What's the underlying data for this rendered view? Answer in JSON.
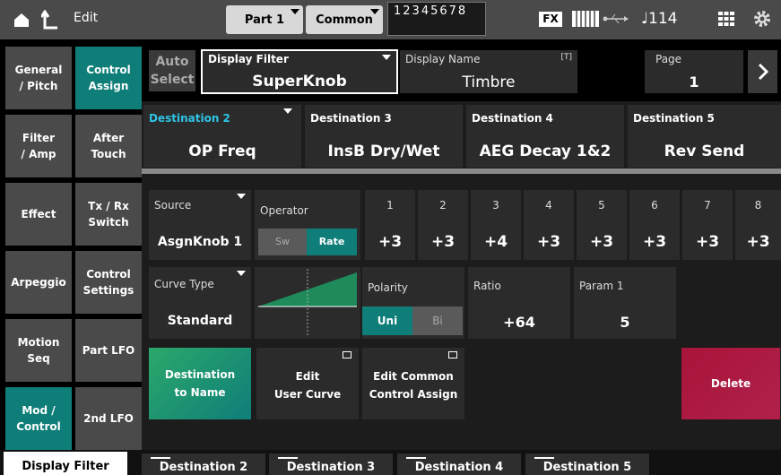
{
  "topbar": {
    "edit_label": "Edit",
    "part_label": "Part 1",
    "common_label": "Common",
    "part_numbers": "12345678",
    "fx_label": "FX",
    "tempo": "♩114"
  },
  "left_tabs": [
    {
      "label": "General\n/ Pitch"
    },
    {
      "label": "Control\nAssign"
    },
    {
      "label": "Filter\n/ Amp"
    },
    {
      "label": "After\nTouch"
    },
    {
      "label": "Effect"
    },
    {
      "label": "Tx / Rx\nSwitch"
    },
    {
      "label": "Arpeggio"
    },
    {
      "label": "Control\nSettings"
    },
    {
      "label": "Motion Seq"
    },
    {
      "label": "Part LFO"
    },
    {
      "label": "Mod /\nControl"
    },
    {
      "label": "2nd LFO"
    }
  ],
  "header": {
    "auto_select_label": "Auto\nSelect",
    "display_filter_label": "Display Filter",
    "display_filter_value": "SuperKnob",
    "display_name_label": "Display Name",
    "display_name_badge": "[T]",
    "display_name_value": "Timbre",
    "page_label": "Page",
    "page_value": "1"
  },
  "destinations": [
    {
      "label": "Destination 2",
      "value": "OP Freq"
    },
    {
      "label": "Destination 3",
      "value": "InsB Dry/Wet"
    },
    {
      "label": "Destination 4",
      "value": "AEG Decay 1&2"
    },
    {
      "label": "Destination 5",
      "value": "Rev Send"
    }
  ],
  "source": {
    "label": "Source",
    "value": "AsgnKnob 1"
  },
  "operator": {
    "label": "Operator",
    "sw_label": "Sw",
    "rate_label": "Rate"
  },
  "operator_values": [
    {
      "num": "1",
      "value": "+3"
    },
    {
      "num": "2",
      "value": "+3"
    },
    {
      "num": "3",
      "value": "+4"
    },
    {
      "num": "4",
      "value": "+3"
    },
    {
      "num": "5",
      "value": "+3"
    },
    {
      "num": "6",
      "value": "+3"
    },
    {
      "num": "7",
      "value": "+3"
    },
    {
      "num": "8",
      "value": "+3"
    }
  ],
  "curve": {
    "label": "Curve Type",
    "value": "Standard"
  },
  "polarity": {
    "label": "Polarity",
    "uni_label": "Uni",
    "bi_label": "Bi"
  },
  "ratio": {
    "label": "Ratio",
    "value": "+64"
  },
  "param1": {
    "label": "Param 1",
    "value": "5"
  },
  "buttons": {
    "dest_to_name": "Destination\nto Name",
    "edit_user_curve": "Edit\nUser Curve",
    "edit_common": "Edit Common\nControl Assign",
    "delete": "Delete"
  },
  "bottom_tabs": [
    "Display Filter",
    "Destination 2",
    "Destination 3",
    "Destination 4",
    "Destination 5"
  ],
  "colors": {
    "teal": "#0f7e79",
    "dest_active": "#2ec4e6",
    "uni_active": "#0f7e79",
    "delete": "#b0214a"
  }
}
